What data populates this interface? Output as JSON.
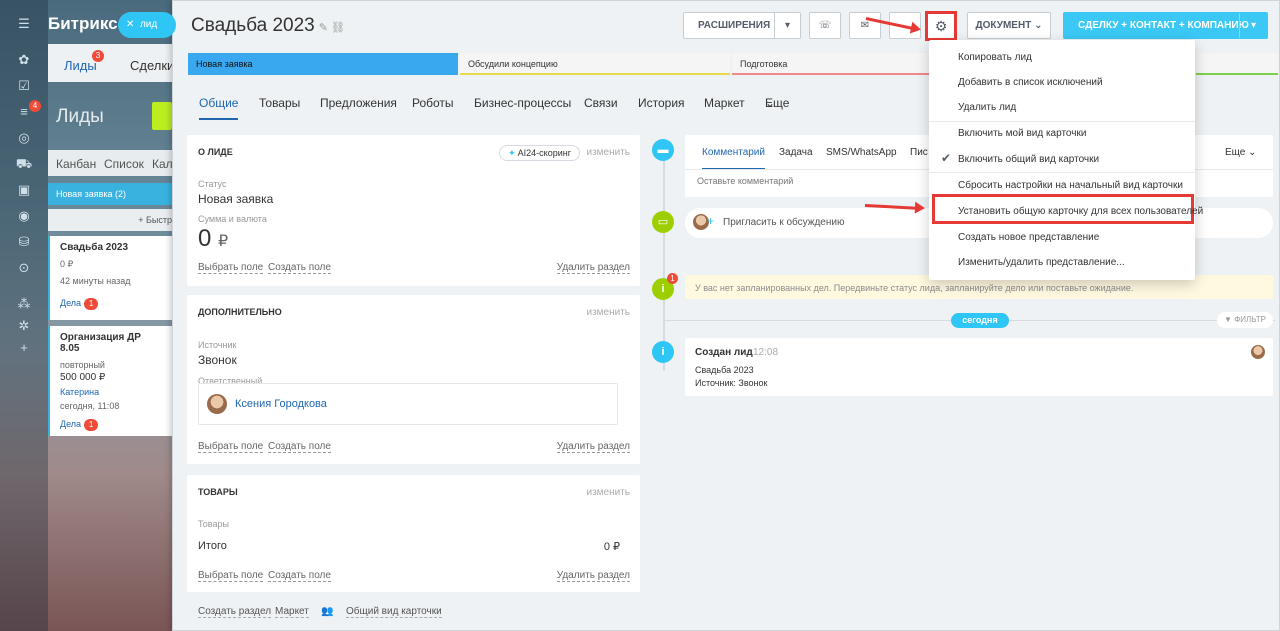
{
  "left_crm": {
    "app_name": "Битрикс",
    "lead_pill": "лид",
    "tabs": [
      "Лиды",
      "Сделки"
    ],
    "tab_badge_leads": "3",
    "page_title": "Лиды",
    "rail_badge": "4",
    "views": [
      "Канбан",
      "Список",
      "Кале"
    ],
    "column_head": "Новая заявка",
    "column_count": "(2)",
    "add_quick": "+ Быстр",
    "cards": [
      {
        "title": "Свадьба 2023",
        "sum": "0 ₽",
        "time": "42 минуты назад",
        "deals": "Дела",
        "deals_count": "1"
      },
      {
        "title": "Организация ДР 8.05",
        "sub": "повторный",
        "sum": "500 000 ₽",
        "person": "Катерина",
        "time": "сегодня, 11:08",
        "deals": "Дела",
        "deals_count": "1"
      }
    ]
  },
  "header": {
    "title": "Свадьба 2023",
    "extensions": "РАСШИРЕНИЯ",
    "document": "ДОКУМЕНТ",
    "convert": "СДЕЛКУ + КОНТАКТ + КОМПАНИЮ"
  },
  "stages": [
    "Новая заявка",
    "Обсудили концепцию",
    "Подготовка"
  ],
  "tabs": [
    "Общие",
    "Товары",
    "Предложения",
    "Роботы",
    "Бизнес-процессы",
    "Связи",
    "История",
    "Маркет",
    "Еще"
  ],
  "about": {
    "header": "О ЛИДЕ",
    "ai_scoring": "AI24-скоринг",
    "change": "изменить",
    "status_label": "Статус",
    "status_value": "Новая заявка",
    "sum_label": "Сумма и валюта",
    "sum_value": "0",
    "currency": "₽",
    "select_field": "Выбрать поле",
    "create_field": "Создать поле",
    "delete_section": "Удалить раздел"
  },
  "extra": {
    "header": "ДОПОЛНИТЕЛЬНО",
    "change": "изменить",
    "source_label": "Источник",
    "source_value": "Звонок",
    "resp_label": "Ответственный",
    "resp_name": "Ксения Городкова",
    "select_field": "Выбрать поле",
    "create_field": "Создать поле",
    "delete_section": "Удалить раздел"
  },
  "products": {
    "header": "ТОВАРЫ",
    "change": "изменить",
    "products_label": "Товары",
    "total_label": "Итого",
    "total_value": "0 ₽",
    "select_field": "Выбрать поле",
    "create_field": "Создать поле",
    "delete_section": "Удалить раздел"
  },
  "bottom": {
    "create_section": "Создать раздел",
    "market": "Маркет",
    "common_view": "Общий вид карточки"
  },
  "timeline": {
    "tabs": [
      "Комментарий",
      "Задача",
      "SMS/WhatsApp",
      "Пис"
    ],
    "more": "Еще",
    "comment_placeholder": "Оставьте комментарий",
    "invite": "Пригласить к обсуждению",
    "no_tasks": "У вас нет запланированных дел. Передвиньте статус лида, запланируйте дело или поставьте ожидание.",
    "no_tasks_badge": "1",
    "today": "сегодня",
    "filter": "ФИЛЬТР",
    "event_title": "Создан лид",
    "event_time": "12:08",
    "event_line1": "Свадьба 2023",
    "event_line2": "Источник: Звонок"
  },
  "menu": {
    "items": [
      "Копировать лид",
      "Добавить в список исключений",
      "Удалить лид",
      "Включить мой вид карточки",
      "Включить общий вид карточки",
      "Сбросить настройки на начальный вид карточки",
      "Установить общую карточку для всех пользователей",
      "Создать новое представление",
      "Изменить/удалить представление..."
    ]
  },
  "colors": {
    "accent": "#2fc6f6",
    "highlight": "#e53935",
    "stage_active": "#39a8ef"
  }
}
